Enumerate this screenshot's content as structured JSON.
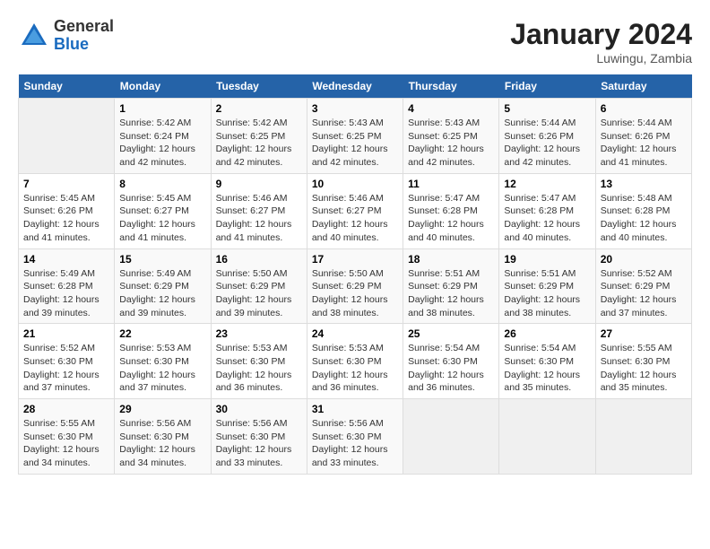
{
  "logo": {
    "general": "General",
    "blue": "Blue"
  },
  "title": {
    "month": "January 2024",
    "location": "Luwingu, Zambia"
  },
  "headers": [
    "Sunday",
    "Monday",
    "Tuesday",
    "Wednesday",
    "Thursday",
    "Friday",
    "Saturday"
  ],
  "weeks": [
    [
      {
        "num": "",
        "info": ""
      },
      {
        "num": "1",
        "info": "Sunrise: 5:42 AM\nSunset: 6:24 PM\nDaylight: 12 hours\nand 42 minutes."
      },
      {
        "num": "2",
        "info": "Sunrise: 5:42 AM\nSunset: 6:25 PM\nDaylight: 12 hours\nand 42 minutes."
      },
      {
        "num": "3",
        "info": "Sunrise: 5:43 AM\nSunset: 6:25 PM\nDaylight: 12 hours\nand 42 minutes."
      },
      {
        "num": "4",
        "info": "Sunrise: 5:43 AM\nSunset: 6:25 PM\nDaylight: 12 hours\nand 42 minutes."
      },
      {
        "num": "5",
        "info": "Sunrise: 5:44 AM\nSunset: 6:26 PM\nDaylight: 12 hours\nand 42 minutes."
      },
      {
        "num": "6",
        "info": "Sunrise: 5:44 AM\nSunset: 6:26 PM\nDaylight: 12 hours\nand 41 minutes."
      }
    ],
    [
      {
        "num": "7",
        "info": "Sunrise: 5:45 AM\nSunset: 6:26 PM\nDaylight: 12 hours\nand 41 minutes."
      },
      {
        "num": "8",
        "info": "Sunrise: 5:45 AM\nSunset: 6:27 PM\nDaylight: 12 hours\nand 41 minutes."
      },
      {
        "num": "9",
        "info": "Sunrise: 5:46 AM\nSunset: 6:27 PM\nDaylight: 12 hours\nand 41 minutes."
      },
      {
        "num": "10",
        "info": "Sunrise: 5:46 AM\nSunset: 6:27 PM\nDaylight: 12 hours\nand 40 minutes."
      },
      {
        "num": "11",
        "info": "Sunrise: 5:47 AM\nSunset: 6:28 PM\nDaylight: 12 hours\nand 40 minutes."
      },
      {
        "num": "12",
        "info": "Sunrise: 5:47 AM\nSunset: 6:28 PM\nDaylight: 12 hours\nand 40 minutes."
      },
      {
        "num": "13",
        "info": "Sunrise: 5:48 AM\nSunset: 6:28 PM\nDaylight: 12 hours\nand 40 minutes."
      }
    ],
    [
      {
        "num": "14",
        "info": "Sunrise: 5:49 AM\nSunset: 6:28 PM\nDaylight: 12 hours\nand 39 minutes."
      },
      {
        "num": "15",
        "info": "Sunrise: 5:49 AM\nSunset: 6:29 PM\nDaylight: 12 hours\nand 39 minutes."
      },
      {
        "num": "16",
        "info": "Sunrise: 5:50 AM\nSunset: 6:29 PM\nDaylight: 12 hours\nand 39 minutes."
      },
      {
        "num": "17",
        "info": "Sunrise: 5:50 AM\nSunset: 6:29 PM\nDaylight: 12 hours\nand 38 minutes."
      },
      {
        "num": "18",
        "info": "Sunrise: 5:51 AM\nSunset: 6:29 PM\nDaylight: 12 hours\nand 38 minutes."
      },
      {
        "num": "19",
        "info": "Sunrise: 5:51 AM\nSunset: 6:29 PM\nDaylight: 12 hours\nand 38 minutes."
      },
      {
        "num": "20",
        "info": "Sunrise: 5:52 AM\nSunset: 6:29 PM\nDaylight: 12 hours\nand 37 minutes."
      }
    ],
    [
      {
        "num": "21",
        "info": "Sunrise: 5:52 AM\nSunset: 6:30 PM\nDaylight: 12 hours\nand 37 minutes."
      },
      {
        "num": "22",
        "info": "Sunrise: 5:53 AM\nSunset: 6:30 PM\nDaylight: 12 hours\nand 37 minutes."
      },
      {
        "num": "23",
        "info": "Sunrise: 5:53 AM\nSunset: 6:30 PM\nDaylight: 12 hours\nand 36 minutes."
      },
      {
        "num": "24",
        "info": "Sunrise: 5:53 AM\nSunset: 6:30 PM\nDaylight: 12 hours\nand 36 minutes."
      },
      {
        "num": "25",
        "info": "Sunrise: 5:54 AM\nSunset: 6:30 PM\nDaylight: 12 hours\nand 36 minutes."
      },
      {
        "num": "26",
        "info": "Sunrise: 5:54 AM\nSunset: 6:30 PM\nDaylight: 12 hours\nand 35 minutes."
      },
      {
        "num": "27",
        "info": "Sunrise: 5:55 AM\nSunset: 6:30 PM\nDaylight: 12 hours\nand 35 minutes."
      }
    ],
    [
      {
        "num": "28",
        "info": "Sunrise: 5:55 AM\nSunset: 6:30 PM\nDaylight: 12 hours\nand 34 minutes."
      },
      {
        "num": "29",
        "info": "Sunrise: 5:56 AM\nSunset: 6:30 PM\nDaylight: 12 hours\nand 34 minutes."
      },
      {
        "num": "30",
        "info": "Sunrise: 5:56 AM\nSunset: 6:30 PM\nDaylight: 12 hours\nand 33 minutes."
      },
      {
        "num": "31",
        "info": "Sunrise: 5:56 AM\nSunset: 6:30 PM\nDaylight: 12 hours\nand 33 minutes."
      },
      {
        "num": "",
        "info": ""
      },
      {
        "num": "",
        "info": ""
      },
      {
        "num": "",
        "info": ""
      }
    ]
  ]
}
